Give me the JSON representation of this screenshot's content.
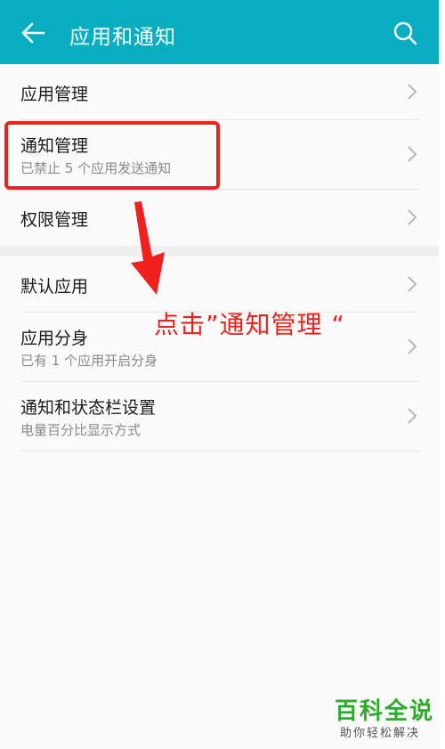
{
  "header": {
    "title": "应用和通知",
    "back_icon": "arrow-left-icon",
    "search_icon": "search-icon",
    "background": "#08aebf"
  },
  "settings_items": [
    {
      "title": "应用管理",
      "subtitle": ""
    },
    {
      "title": "通知管理",
      "subtitle": "已禁止 5 个应用发送通知"
    },
    {
      "title": "权限管理",
      "subtitle": ""
    },
    {
      "title": "默认应用",
      "subtitle": ""
    },
    {
      "title": "应用分身",
      "subtitle": "已有 1 个应用开启分身"
    },
    {
      "title": "通知和状态栏设置",
      "subtitle": "电量百分比显示方式"
    }
  ],
  "annotation": {
    "text": "点击”通知管理 “",
    "color": "#f0201c"
  },
  "watermark": {
    "main": "百科全说",
    "sub": "助你轻松解决"
  }
}
